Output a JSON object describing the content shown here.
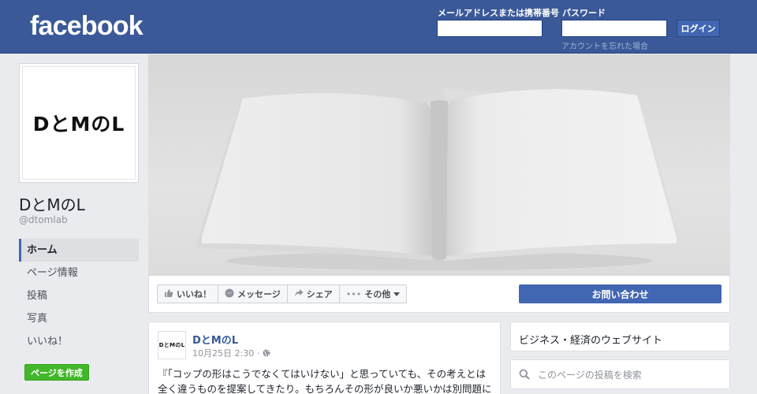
{
  "header": {
    "logo": "facebook",
    "email_label": "メールアドレスまたは携帯番号",
    "password_label": "パスワード",
    "login_button": "ログイン",
    "forgot_link": "アカウントを忘れた場合",
    "email_value": "",
    "password_value": ""
  },
  "page": {
    "logo_text": "DとMのL",
    "name": "DとMのL",
    "handle": "@dtomlab"
  },
  "nav": {
    "items": [
      {
        "label": "ホーム",
        "active": true
      },
      {
        "label": "ページ情報"
      },
      {
        "label": "投稿"
      },
      {
        "label": "写真"
      },
      {
        "label": "いいね！"
      }
    ],
    "create_page": "ページを作成"
  },
  "actions": {
    "like": "いいね！",
    "message": "メッセージ",
    "share": "シェア",
    "more": "その他",
    "contact": "お問い合わせ"
  },
  "post": {
    "avatar_text": "DとMのL",
    "author": "DとMのL",
    "time": "10月25日 2:30 ·",
    "text_line1": "『「コップの形はこうでなくてはいけない」と思っていても、その考えとは",
    "text_line2": "全く違うものを提案してきたり。もちろんその形が良いか悪いかは別問題に"
  },
  "sidebar": {
    "category": "ビジネス・経済のウェブサイト",
    "search_placeholder": "このページの投稿を検索"
  },
  "colors": {
    "brand": "#3b5998",
    "button_blue": "#4267b2",
    "create_green": "#42b72a"
  },
  "icons": [
    "thumbs-up-icon",
    "message-icon",
    "share-icon",
    "more-icon",
    "chevron-down-icon",
    "globe-icon",
    "search-icon"
  ]
}
